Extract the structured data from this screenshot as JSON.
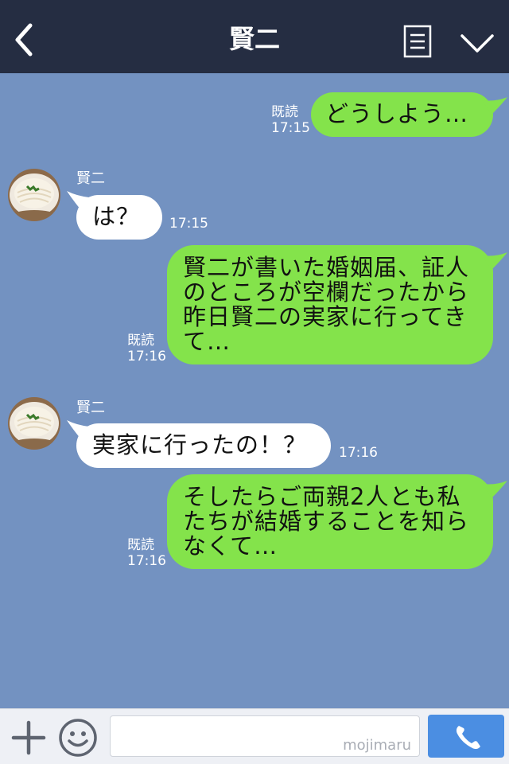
{
  "header": {
    "title": "賢二",
    "back_icon": "chevron-left-icon",
    "menu_icon": "list-icon",
    "more_icon": "chevron-down-icon",
    "background": "#252d42"
  },
  "chat": {
    "background": "#7392c1",
    "messages": [
      {
        "direction": "out",
        "lines": [
          "どうしよう…"
        ],
        "read": "既読",
        "time": "17:15"
      },
      {
        "direction": "in",
        "sender": "賢二",
        "lines": [
          "は？"
        ],
        "time": "17:15"
      },
      {
        "direction": "out",
        "lines": [
          "賢二が書いた婚姻届、証人",
          "のところが空欄だったから",
          "昨日賢二の実家に行ってき",
          "て…"
        ],
        "read": "既読",
        "time": "17:16"
      },
      {
        "direction": "in",
        "sender": "賢二",
        "lines": [
          "実家に行ったの！？"
        ],
        "time": "17:16"
      },
      {
        "direction": "out",
        "lines": [
          "そしたらご両親2人とも私",
          "たちが結婚することを知ら",
          "なくて…"
        ],
        "read": "既読",
        "time": "17:16"
      }
    ]
  },
  "input_bar": {
    "plus_icon": "plus-icon",
    "emoji_icon": "smiley-icon",
    "placeholder": "",
    "watermark": "mojimaru",
    "call_icon": "phone-icon",
    "call_color": "#4b8ee2"
  },
  "colors": {
    "outgoing_bubble": "#84e34b",
    "incoming_bubble": "#ffffff"
  }
}
